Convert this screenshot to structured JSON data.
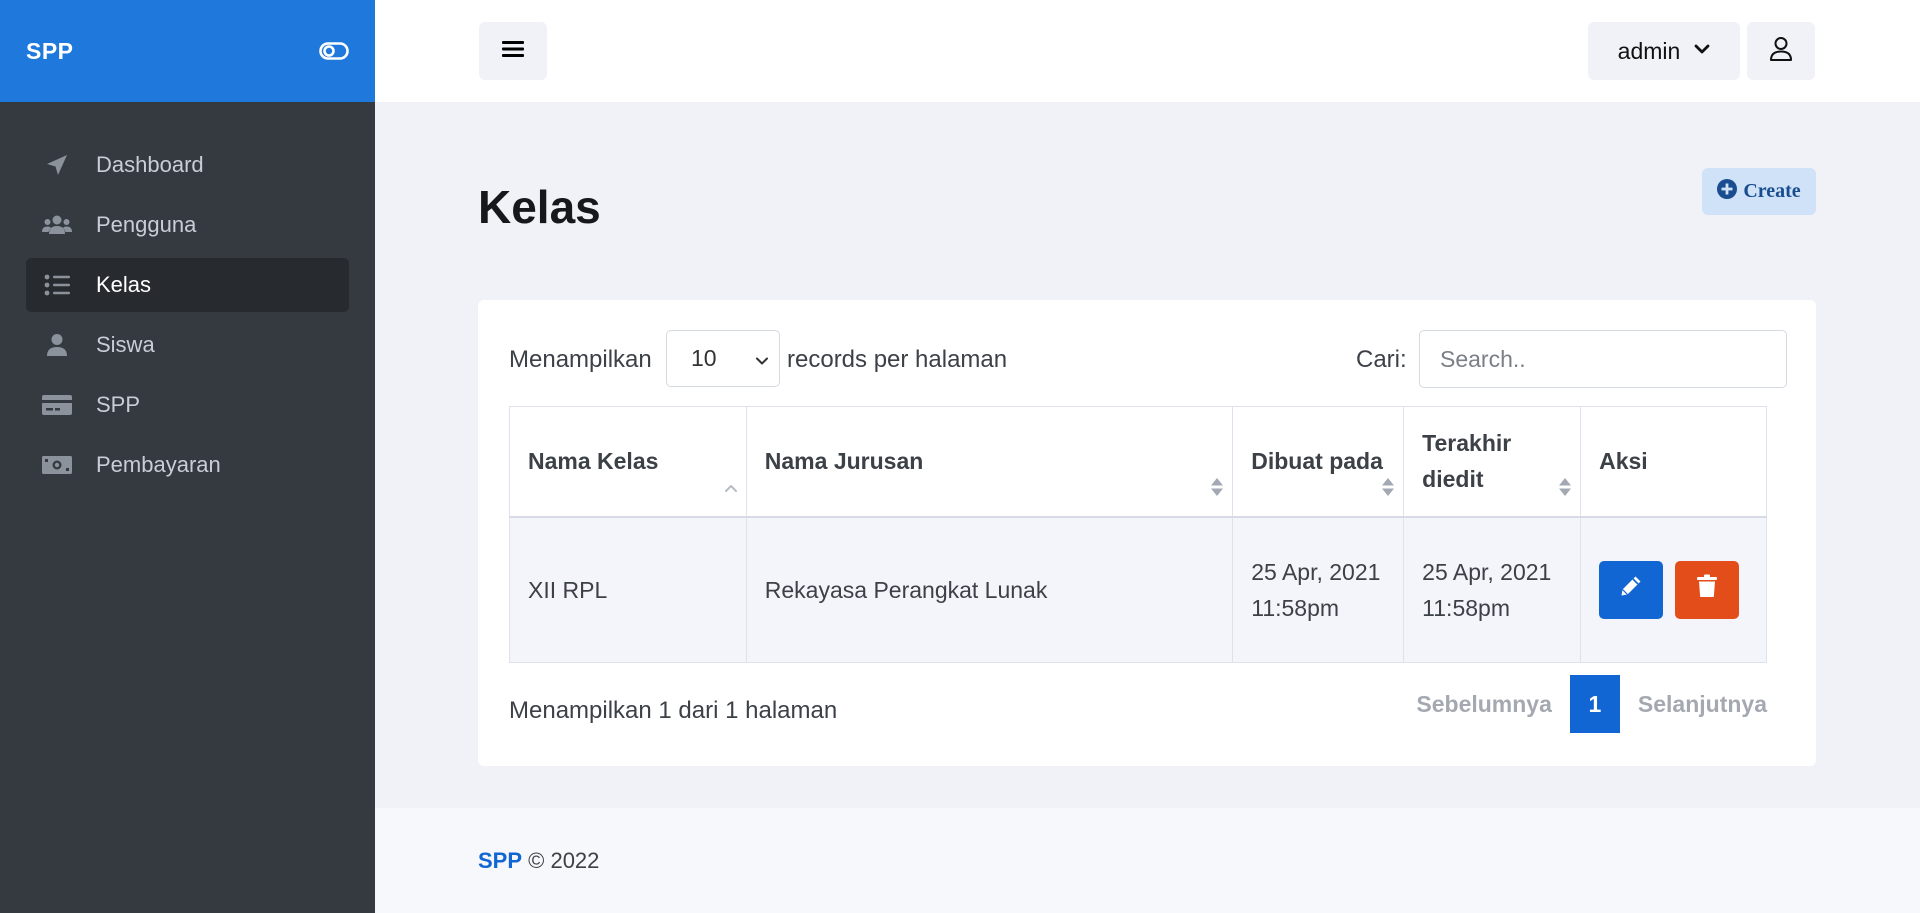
{
  "sidebar": {
    "brand": "SPP",
    "items": [
      {
        "label": "Dashboard",
        "icon": "paper-plane-icon"
      },
      {
        "label": "Pengguna",
        "icon": "users-icon"
      },
      {
        "label": "Kelas",
        "icon": "list-icon",
        "active": true
      },
      {
        "label": "Siswa",
        "icon": "user-icon"
      },
      {
        "label": "SPP",
        "icon": "credit-card-icon"
      },
      {
        "label": "Pembayaran",
        "icon": "money-bill-icon"
      }
    ]
  },
  "header": {
    "user_name": "admin"
  },
  "main": {
    "title": "Kelas",
    "create_label": "Create",
    "show_label": "Menampilkan",
    "page_size": "10",
    "per_page_label": "records per halaman",
    "search_label": "Cari:",
    "search_placeholder": "Search..",
    "table": {
      "columns": [
        "Nama Kelas",
        "Nama Jurusan",
        "Dibuat pada",
        "Terakhir diedit",
        "Aksi"
      ],
      "rows": [
        {
          "nama_kelas": "XII RPL",
          "nama_jurusan": "Rekayasa Perangkat Lunak",
          "dibuat": "25 Apr, 2021 11:58pm",
          "diedit": "25 Apr, 2021 11:58pm"
        }
      ]
    },
    "info": "Menampilkan 1 dari 1 halaman",
    "pagination": {
      "prev": "Sebelumnya",
      "current": "1",
      "next": "Selanjutnya"
    }
  },
  "footer": {
    "brand": "SPP",
    "text": " © 2022"
  },
  "colors": {
    "brand": "#1f78db",
    "sidebar": "#343a40",
    "primary": "#1266d4",
    "danger": "#e34d1a"
  }
}
